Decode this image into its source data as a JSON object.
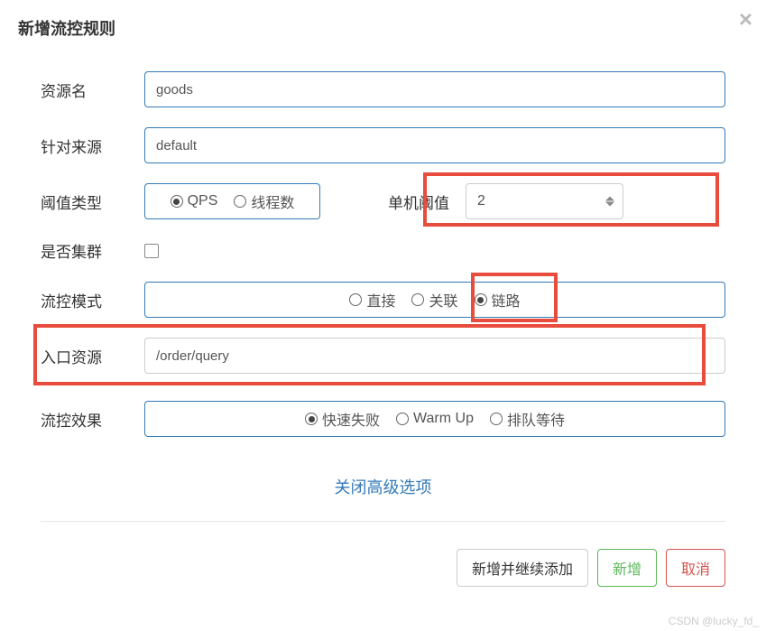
{
  "header": {
    "title": "新增流控规则"
  },
  "form": {
    "resourceName": {
      "label": "资源名",
      "value": "goods"
    },
    "source": {
      "label": "针对来源",
      "value": "default"
    },
    "thresholdType": {
      "label": "阈值类型",
      "options": {
        "qps": "QPS",
        "threads": "线程数"
      },
      "selected": "qps"
    },
    "threshold": {
      "label": "单机阈值",
      "value": "2"
    },
    "cluster": {
      "label": "是否集群",
      "checked": false
    },
    "flowMode": {
      "label": "流控模式",
      "options": {
        "direct": "直接",
        "relate": "关联",
        "chain": "链路"
      },
      "selected": "chain"
    },
    "entryResource": {
      "label": "入口资源",
      "value": "/order/query"
    },
    "flowEffect": {
      "label": "流控效果",
      "options": {
        "fastFail": "快速失败",
        "warmUp": "Warm Up",
        "queueWait": "排队等待"
      },
      "selected": "fastFail"
    }
  },
  "advanced": {
    "link": "关闭高级选项"
  },
  "footer": {
    "addContinue": "新增并继续添加",
    "add": "新增",
    "cancel": "取消"
  },
  "watermark": "CSDN @lucky_fd_"
}
